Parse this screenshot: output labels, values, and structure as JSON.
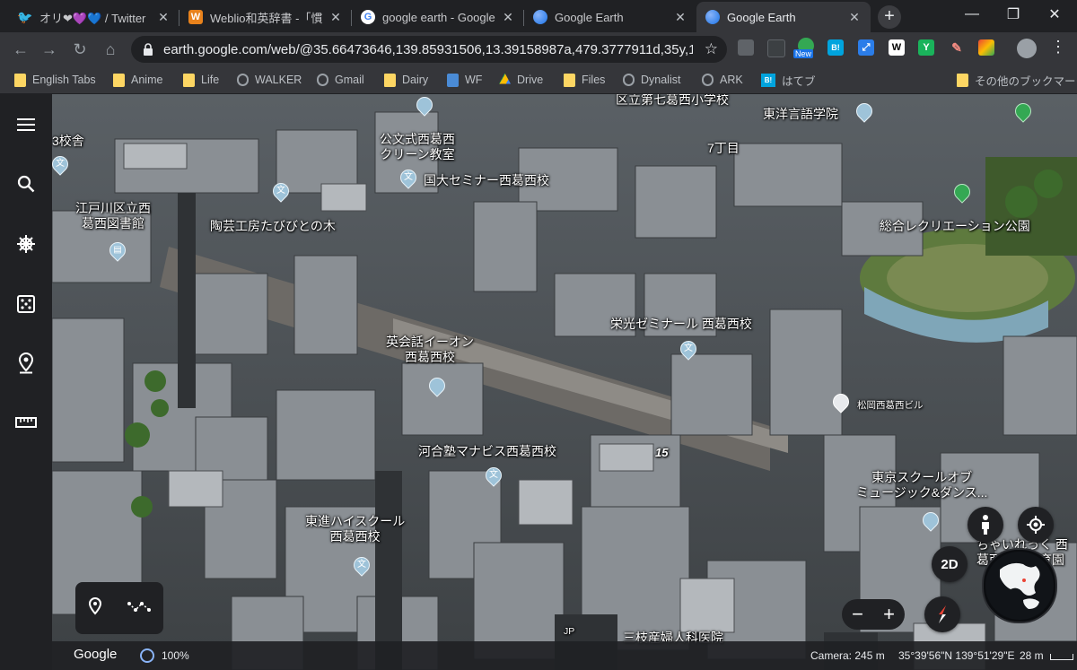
{
  "tabs": [
    {
      "title": "オリ❤💜💙 / Twitter",
      "icon": "twitter-icon",
      "color": "#1da1f2",
      "active": false
    },
    {
      "title": "Weblio和英辞書 -「慣",
      "icon": "weblio-icon",
      "color": "#e8821c",
      "active": false
    },
    {
      "title": "google earth - Google",
      "icon": "google-g-icon",
      "color": "#ffffff",
      "active": false
    },
    {
      "title": "Google Earth",
      "icon": "earth-icon",
      "color": "#4285f4",
      "active": false
    },
    {
      "title": "Google Earth",
      "icon": "earth-icon",
      "color": "#4285f4",
      "active": true
    }
  ],
  "address": {
    "url": "earth.google.com/web/@35.66473646,139.85931506,13.39158987a,479.3777911d,35y,14..."
  },
  "extensions": [
    {
      "name": "ext-gray-icon",
      "color": "#5f6368",
      "text": ""
    },
    {
      "name": "ext-dark-icon",
      "color": "#3c4043",
      "text": ""
    },
    {
      "name": "ext-green-new-icon",
      "color": "#34a853",
      "text": "",
      "badge": "New"
    },
    {
      "name": "ext-hatena-icon",
      "color": "#00a4de",
      "text": "B!"
    },
    {
      "name": "ext-arrow-icon",
      "color": "#2b7de9",
      "text": "⤢"
    },
    {
      "name": "ext-w-icon",
      "color": "#ffffff",
      "text": "W"
    },
    {
      "name": "ext-y-icon",
      "color": "#1ab35b",
      "text": "Y"
    },
    {
      "name": "ext-pen-icon",
      "color": "#c5221f",
      "text": "✎"
    },
    {
      "name": "ext-rainbow-icon",
      "color": "#fbbc04",
      "text": ""
    }
  ],
  "bookmarks": [
    {
      "label": "English Tabs",
      "type": "folder"
    },
    {
      "label": "Anime",
      "type": "folder"
    },
    {
      "label": "Life",
      "type": "folder"
    },
    {
      "label": "WALKER",
      "type": "site"
    },
    {
      "label": "Gmail",
      "type": "site"
    },
    {
      "label": "Dairy",
      "type": "folder"
    },
    {
      "label": "WF",
      "type": "site"
    },
    {
      "label": "Drive",
      "type": "drive"
    },
    {
      "label": "Files",
      "type": "folder"
    },
    {
      "label": "Dynalist",
      "type": "site"
    },
    {
      "label": "ARK",
      "type": "site"
    },
    {
      "label": "はてブ",
      "type": "hatena"
    }
  ],
  "other_bookmarks": "その他のブックマーク",
  "map_labels": [
    {
      "text": "区立第七葛西小学校",
      "cls": ""
    },
    {
      "text": "東洋言語学院",
      "cls": ""
    },
    {
      "text": "3校舎",
      "cls": ""
    },
    {
      "text": "公文式西葛西\nクリーン教室",
      "cls": ""
    },
    {
      "text": "7丁目",
      "cls": ""
    },
    {
      "text": "国大セミナー西葛西校",
      "cls": ""
    },
    {
      "text": "江戸川区立西\n葛西図書館",
      "cls": ""
    },
    {
      "text": "陶芸工房たびびとの木",
      "cls": ""
    },
    {
      "text": "総合レクリエーション公園",
      "cls": ""
    },
    {
      "text": "栄光ゼミナール 西葛西校",
      "cls": ""
    },
    {
      "text": "英会話イーオン\n西葛西校",
      "cls": ""
    },
    {
      "text": "松岡西葛西ビル",
      "cls": "small"
    },
    {
      "text": "15",
      "cls": ""
    },
    {
      "text": "河合塾マナビス西葛西校",
      "cls": ""
    },
    {
      "text": "東京スクールオブ\nミュージック&ダンス...",
      "cls": ""
    },
    {
      "text": "東進ハイスクール\n西葛西校",
      "cls": ""
    },
    {
      "text": "ちゃいれっく 西\n葛西駅前保育園",
      "cls": ""
    },
    {
      "text": "三枝産婦人科医院",
      "cls": ""
    },
    {
      "text": "JP",
      "cls": "small"
    }
  ],
  "controls": {
    "view_2d": "2D"
  },
  "footer": {
    "brand": "Google",
    "load": "100%",
    "camera": "Camera: 245 m",
    "coords": "35°39'56\"N 139°51'29\"E",
    "scale": "28 m"
  },
  "colors": {
    "chrome_dark": "#202124",
    "chrome_toolbar": "#35363a",
    "accent_blue": "#8ab4f8",
    "folder_yellow": "#fdd663"
  }
}
